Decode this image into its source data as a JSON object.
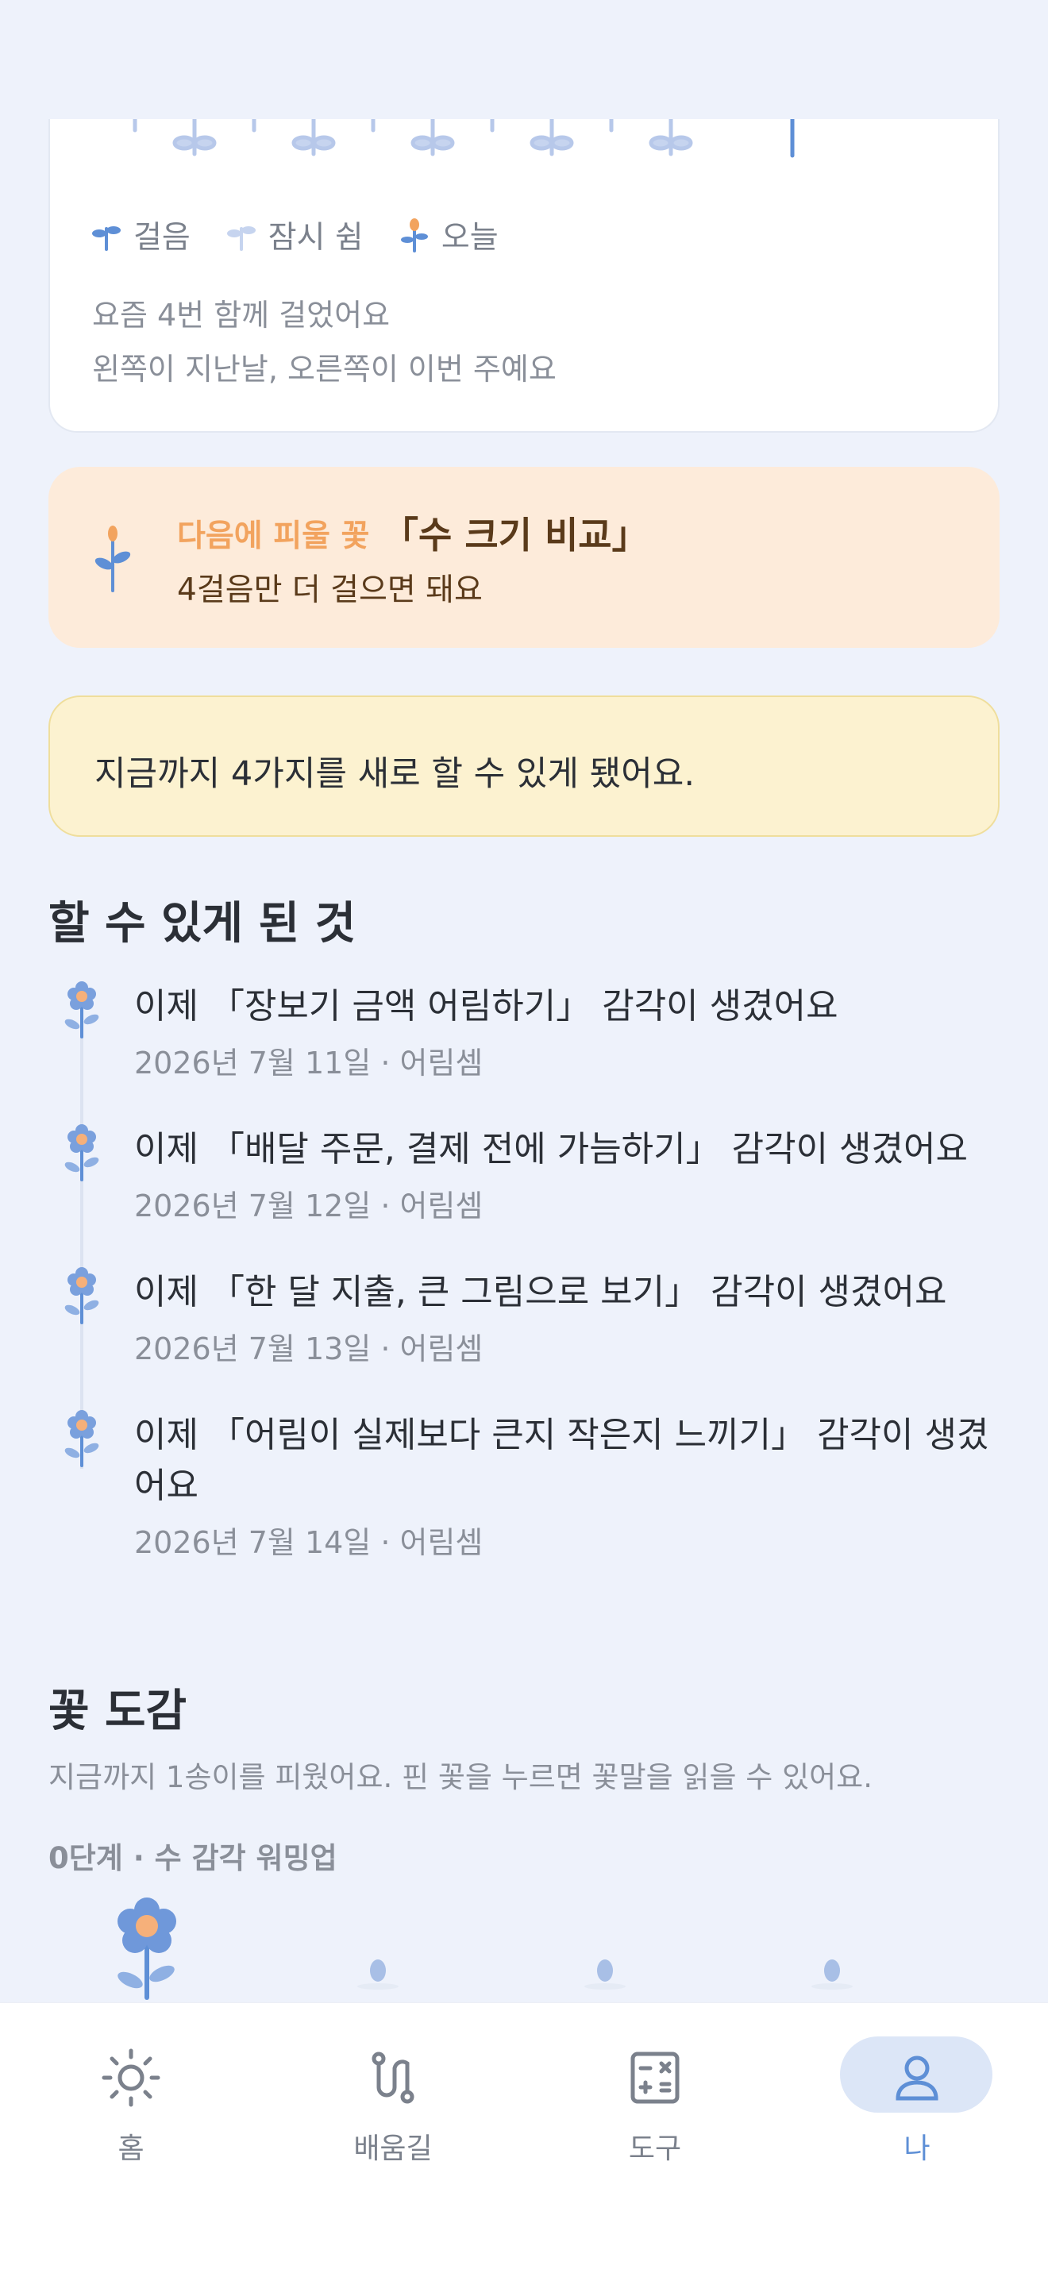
{
  "walk_card": {
    "legend": [
      {
        "icon": "sprout-icon",
        "label": "걸음"
      },
      {
        "icon": "sprout-rest-icon",
        "label": "잠시 쉼"
      },
      {
        "icon": "sprout-today-icon",
        "label": "오늘"
      }
    ],
    "count_text": "요즘 4번 함께 걸었어요",
    "hint_text": "왼쪽이 지난날, 오른쪽이 이번 주예요"
  },
  "next_flower": {
    "label": "다음에 피울 꽃",
    "title": "「수 크기 비교」",
    "subtitle": "4걸음만 더 걸으면 돼요"
  },
  "summary": {
    "text": "지금까지 4가지를 새로 할 수 있게 됐어요."
  },
  "achievements": {
    "title": "할 수 있게 된 것",
    "items": [
      {
        "title": "이제 「장보기 금액 어림하기」 감각이 생겼어요",
        "date": "2026년 7월 11일 · 어림셈"
      },
      {
        "title": "이제 「배달 주문, 결제 전에 가늠하기」 감각이 생겼어요",
        "date": "2026년 7월 12일 · 어림셈"
      },
      {
        "title": "이제 「한 달 지출, 큰 그림으로 보기」 감각이 생겼어요",
        "date": "2026년 7월 13일 · 어림셈"
      },
      {
        "title": "이제 「어림이 실제보다 큰지 작은지 느끼기」 감각이 생겼어요",
        "date": "2026년 7월 14일 · 어림셈"
      }
    ]
  },
  "flower_dex": {
    "title": "꽃 도감",
    "description": "지금까지 1송이를 피웠어요. 핀 꽃을 누르면 꽃말을 읽을 수 있어요.",
    "stage": "0단계 · 수 감각 워밍업"
  },
  "nav": {
    "items": [
      {
        "icon": "sun-icon",
        "label": "홈"
      },
      {
        "icon": "path-icon",
        "label": "배움길"
      },
      {
        "icon": "calculator-icon",
        "label": "도구"
      },
      {
        "icon": "person-icon",
        "label": "나"
      }
    ],
    "active_index": 3
  },
  "colors": {
    "background": "#EEF2FB",
    "accent": "#5E8FD6",
    "orange": "#F2A35E",
    "next_card_bg": "#FDEBDA",
    "summary_bg": "#FCF2D0"
  }
}
